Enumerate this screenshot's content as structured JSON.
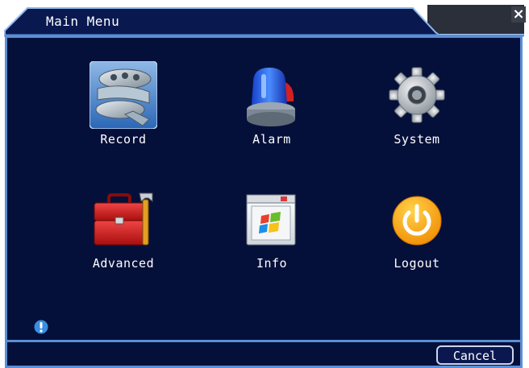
{
  "window": {
    "title": "Main Menu",
    "close_symbol": "×"
  },
  "menu": {
    "items": [
      {
        "label": "Record",
        "icon": "film-reel-icon"
      },
      {
        "label": "Alarm",
        "icon": "siren-icon"
      },
      {
        "label": "System",
        "icon": "gear-icon"
      },
      {
        "label": "Advanced",
        "icon": "toolbox-icon"
      },
      {
        "label": "Info",
        "icon": "window-info-icon"
      },
      {
        "label": "Logout",
        "icon": "power-icon"
      }
    ]
  },
  "footer": {
    "cancel_label": "Cancel"
  },
  "colors": {
    "panel_bg": "#05103a",
    "border": "#5a8fd6",
    "title_bar": "#0a1850"
  }
}
